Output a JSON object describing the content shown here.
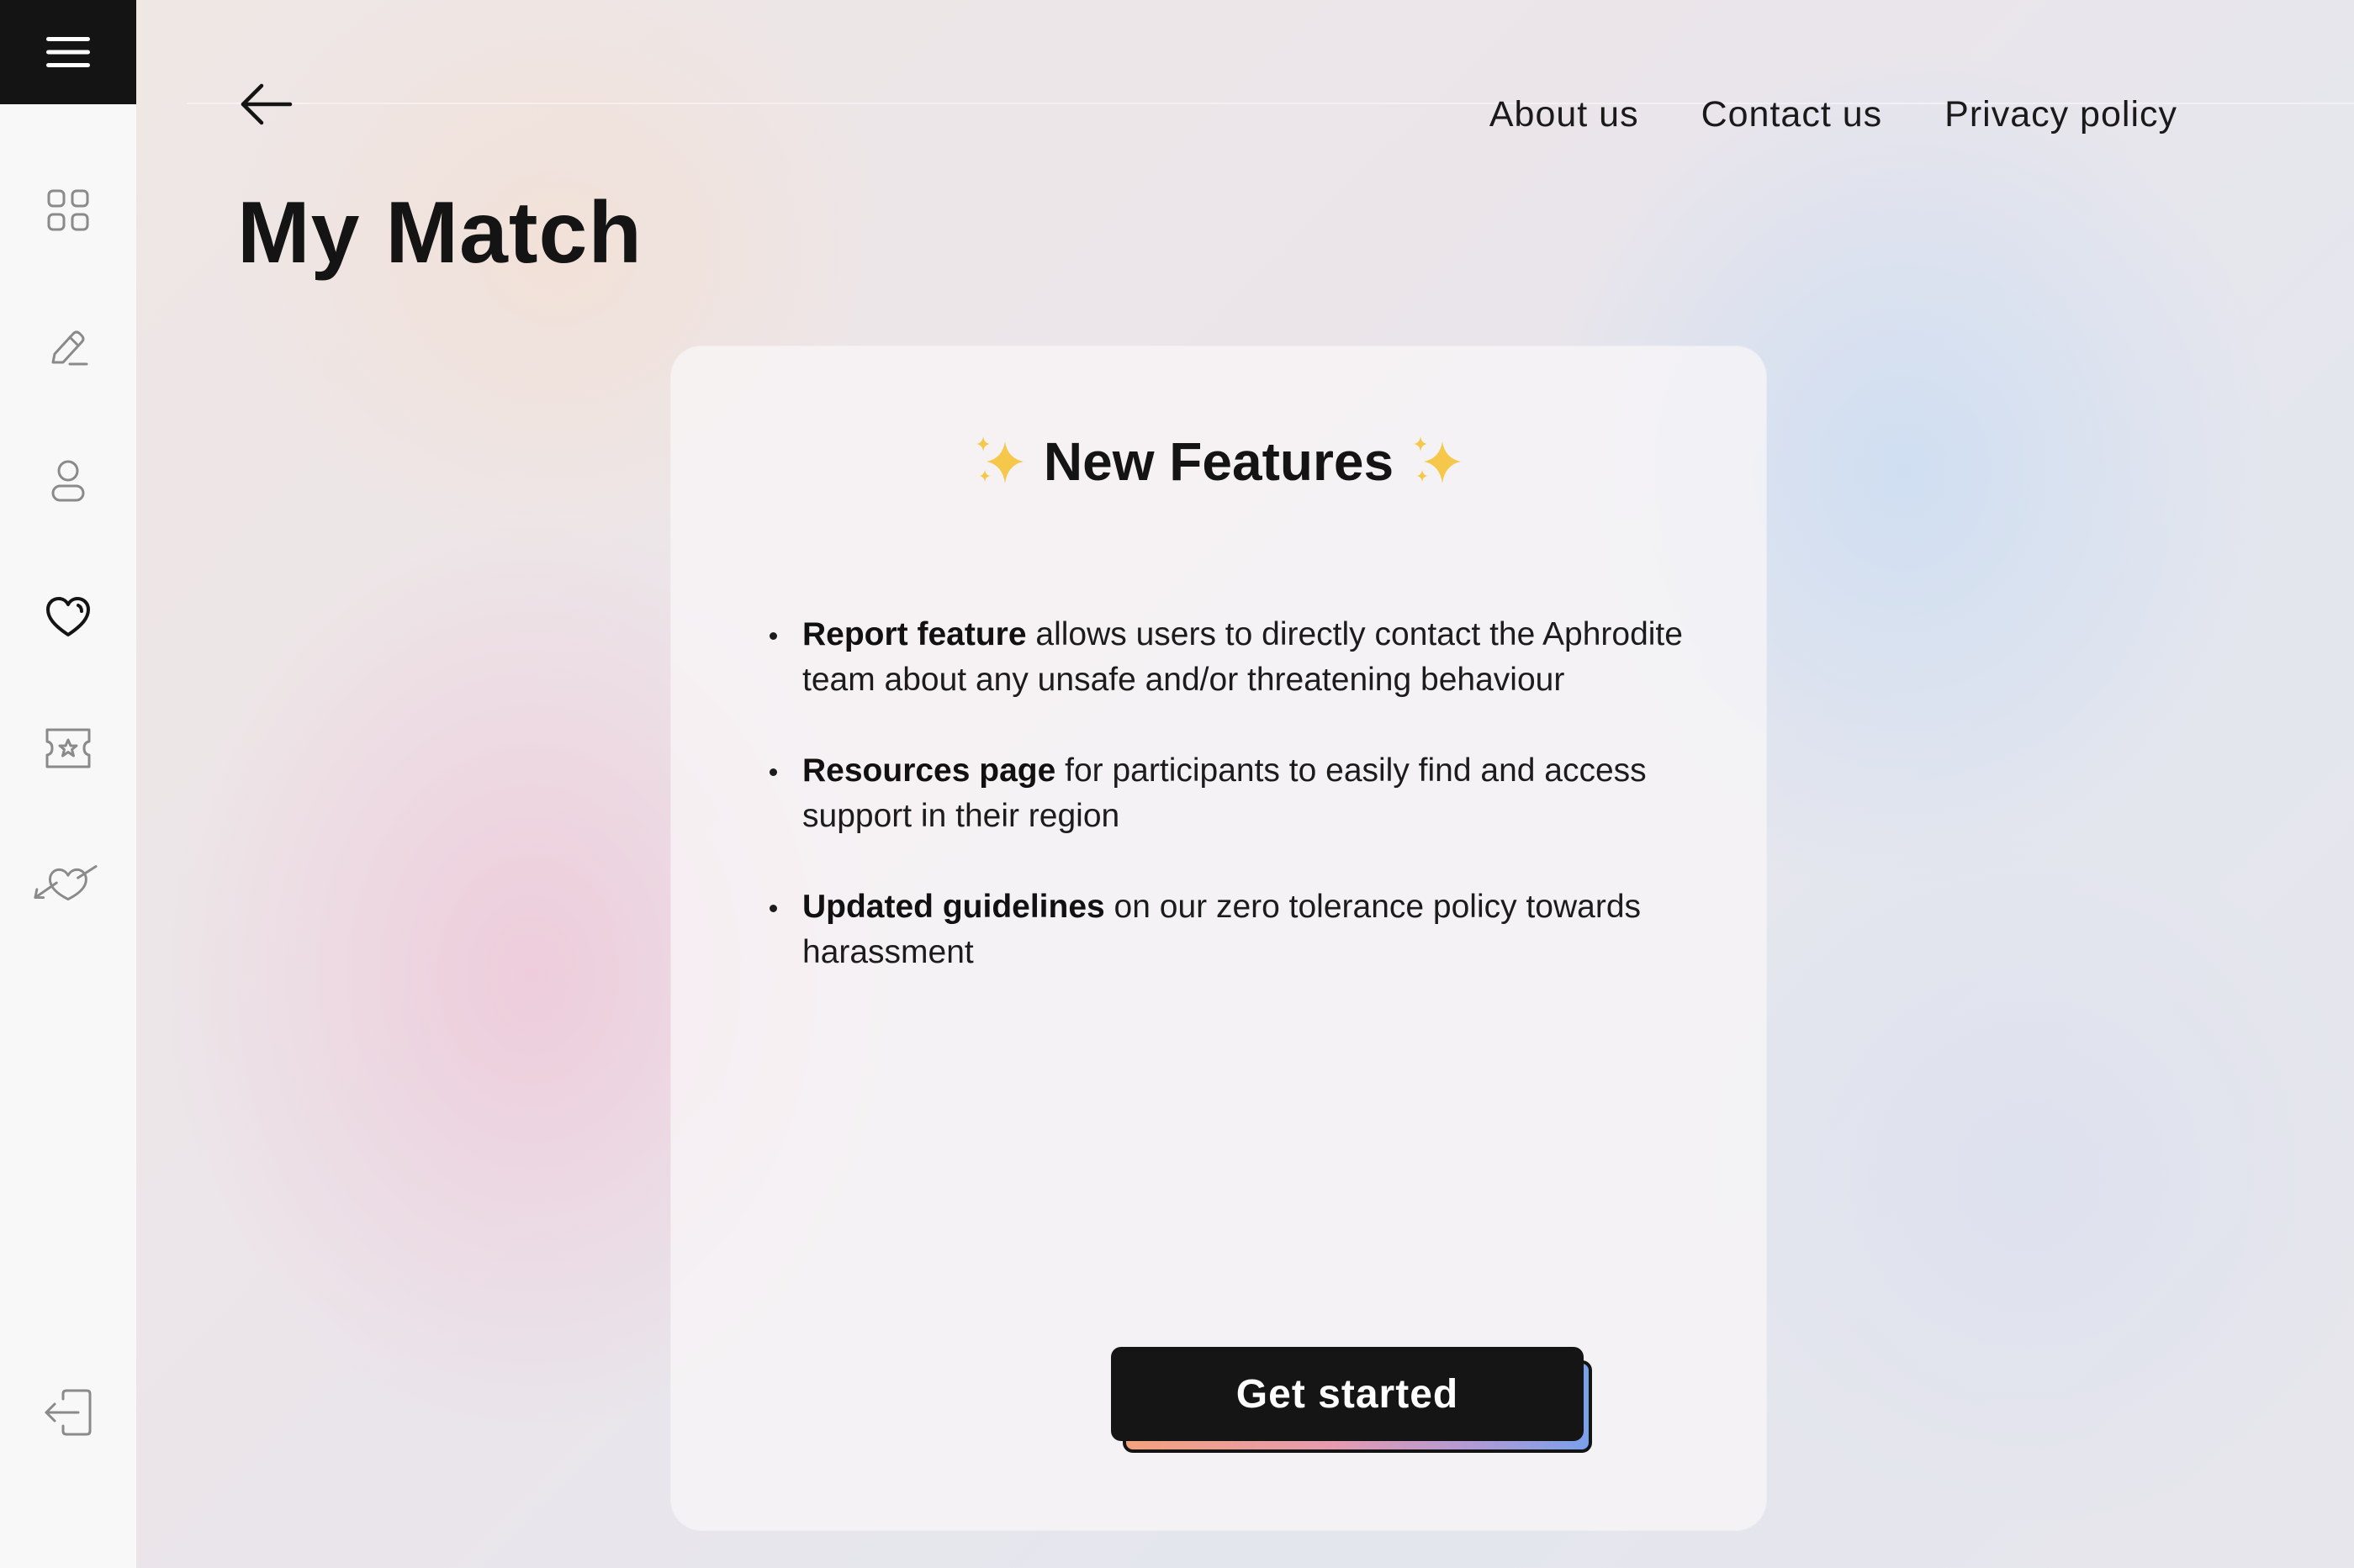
{
  "sidebar": {
    "menu_icon": "hamburger-menu-icon",
    "items": [
      {
        "icon": "grid-icon"
      },
      {
        "icon": "pencil-icon"
      },
      {
        "icon": "profile-icon"
      },
      {
        "icon": "heart-icon",
        "active": true
      },
      {
        "icon": "ticket-star-icon"
      },
      {
        "icon": "flying-heart-icon"
      }
    ],
    "logout_icon": "logout-icon"
  },
  "header": {
    "back_icon": "arrow-left-icon",
    "nav": {
      "about": "About us",
      "contact": "Contact us",
      "privacy": "Privacy policy"
    }
  },
  "page": {
    "title": "My Match"
  },
  "card": {
    "title": "New Features",
    "sparkle_icon": "sparkles-icon",
    "features": [
      {
        "bold": "Report feature",
        "text": " allows users to directly contact the Aphrodite team about any unsafe and/or threatening behaviour"
      },
      {
        "bold": "Resources page",
        "text": " for participants to easily find and access support in their region"
      },
      {
        "bold": "Updated guidelines",
        "text": " on our zero tolerance policy towards harassment"
      }
    ],
    "cta_label": "Get started"
  },
  "colors": {
    "dark": "#141414",
    "sidebar_bg": "#f8f8f8",
    "sparkle": "#f5c84c",
    "cta_gradient": [
      "#f2a27d",
      "#e59bb0",
      "#b19ad6",
      "#7aa0ea"
    ]
  }
}
